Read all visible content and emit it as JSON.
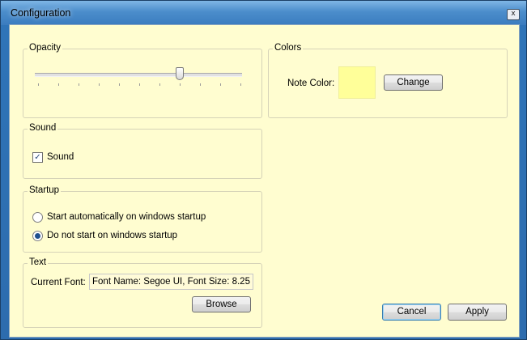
{
  "window": {
    "title": "Configuration",
    "close_symbol": "x"
  },
  "opacity": {
    "legend": "Opacity",
    "value": 0.7,
    "ticks": 11
  },
  "sound": {
    "legend": "Sound",
    "checkbox_label": "Sound",
    "checked": true
  },
  "startup": {
    "legend": "Startup",
    "options": [
      {
        "label": "Start automatically on windows startup",
        "selected": false
      },
      {
        "label": "Do not start on windows startup",
        "selected": true
      }
    ]
  },
  "text": {
    "legend": "Text",
    "current_font_label": "Current Font:",
    "current_font_value": "Font Name: Segoe UI, Font Size: 8.25",
    "browse_label": "Browse"
  },
  "colors": {
    "legend": "Colors",
    "note_color_label": "Note Color:",
    "note_color": "#ffff99",
    "change_label": "Change"
  },
  "footer": {
    "cancel_label": "Cancel",
    "apply_label": "Apply"
  }
}
